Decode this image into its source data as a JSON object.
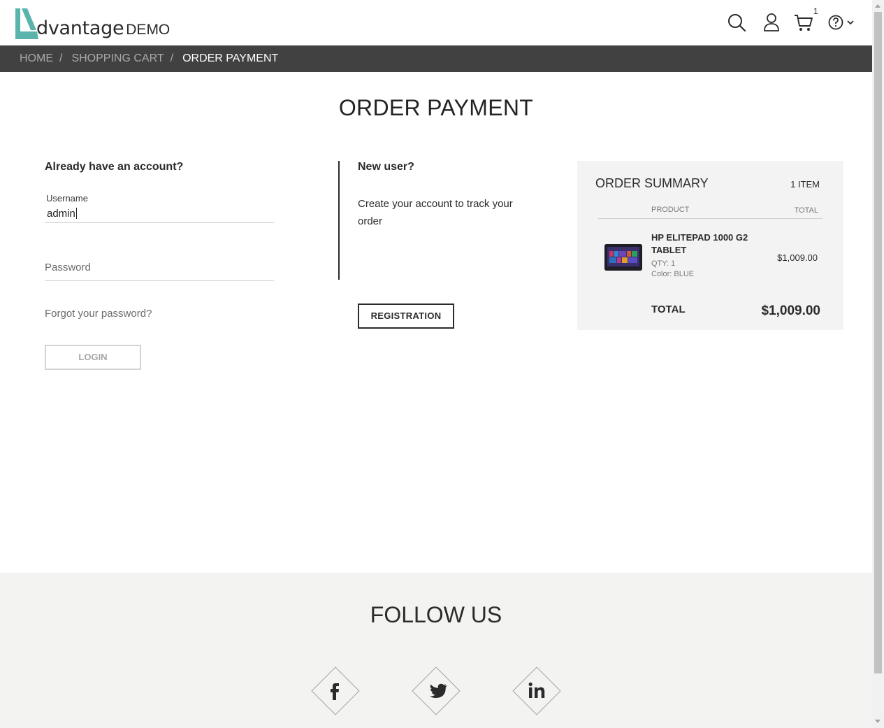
{
  "header": {
    "logo_text": "dvantage",
    "logo_suffix": "DEMO",
    "cart_count": "1",
    "icons": [
      "search-icon",
      "user-icon",
      "cart-icon",
      "help-icon",
      "chevron-down-icon"
    ]
  },
  "breadcrumb": {
    "items": [
      "HOME",
      "SHOPPING CART"
    ],
    "separator": "/",
    "current": "ORDER PAYMENT"
  },
  "page": {
    "title": "ORDER PAYMENT"
  },
  "login": {
    "heading": "Already have an account?",
    "username_label": "Username",
    "username_value": "admin",
    "password_label": "Password",
    "forgot_link": "Forgot your password?",
    "login_button": "LOGIN"
  },
  "new_user": {
    "heading": "New user?",
    "description": "Create your account to track your order",
    "register_button": "REGISTRATION"
  },
  "summary": {
    "title": "ORDER SUMMARY",
    "item_count": "1 ITEM",
    "col_product": "PRODUCT",
    "col_total": "TOTAL",
    "product": {
      "name": "HP ELITEPAD 1000 G2 TABLET",
      "qty": "QTY: 1",
      "color": "Color: BLUE",
      "price": "$1,009.00"
    },
    "total_label": "TOTAL",
    "total_value": "$1,009.00"
  },
  "footer": {
    "follow_title": "FOLLOW US",
    "social": [
      "facebook-icon",
      "twitter-icon",
      "linkedin-icon"
    ]
  },
  "colors": {
    "accent": "#5ab4ac",
    "breadcrumb_bg": "#414141",
    "summary_bg": "#f3f3f3",
    "footer_bg": "#f3f3f1"
  }
}
